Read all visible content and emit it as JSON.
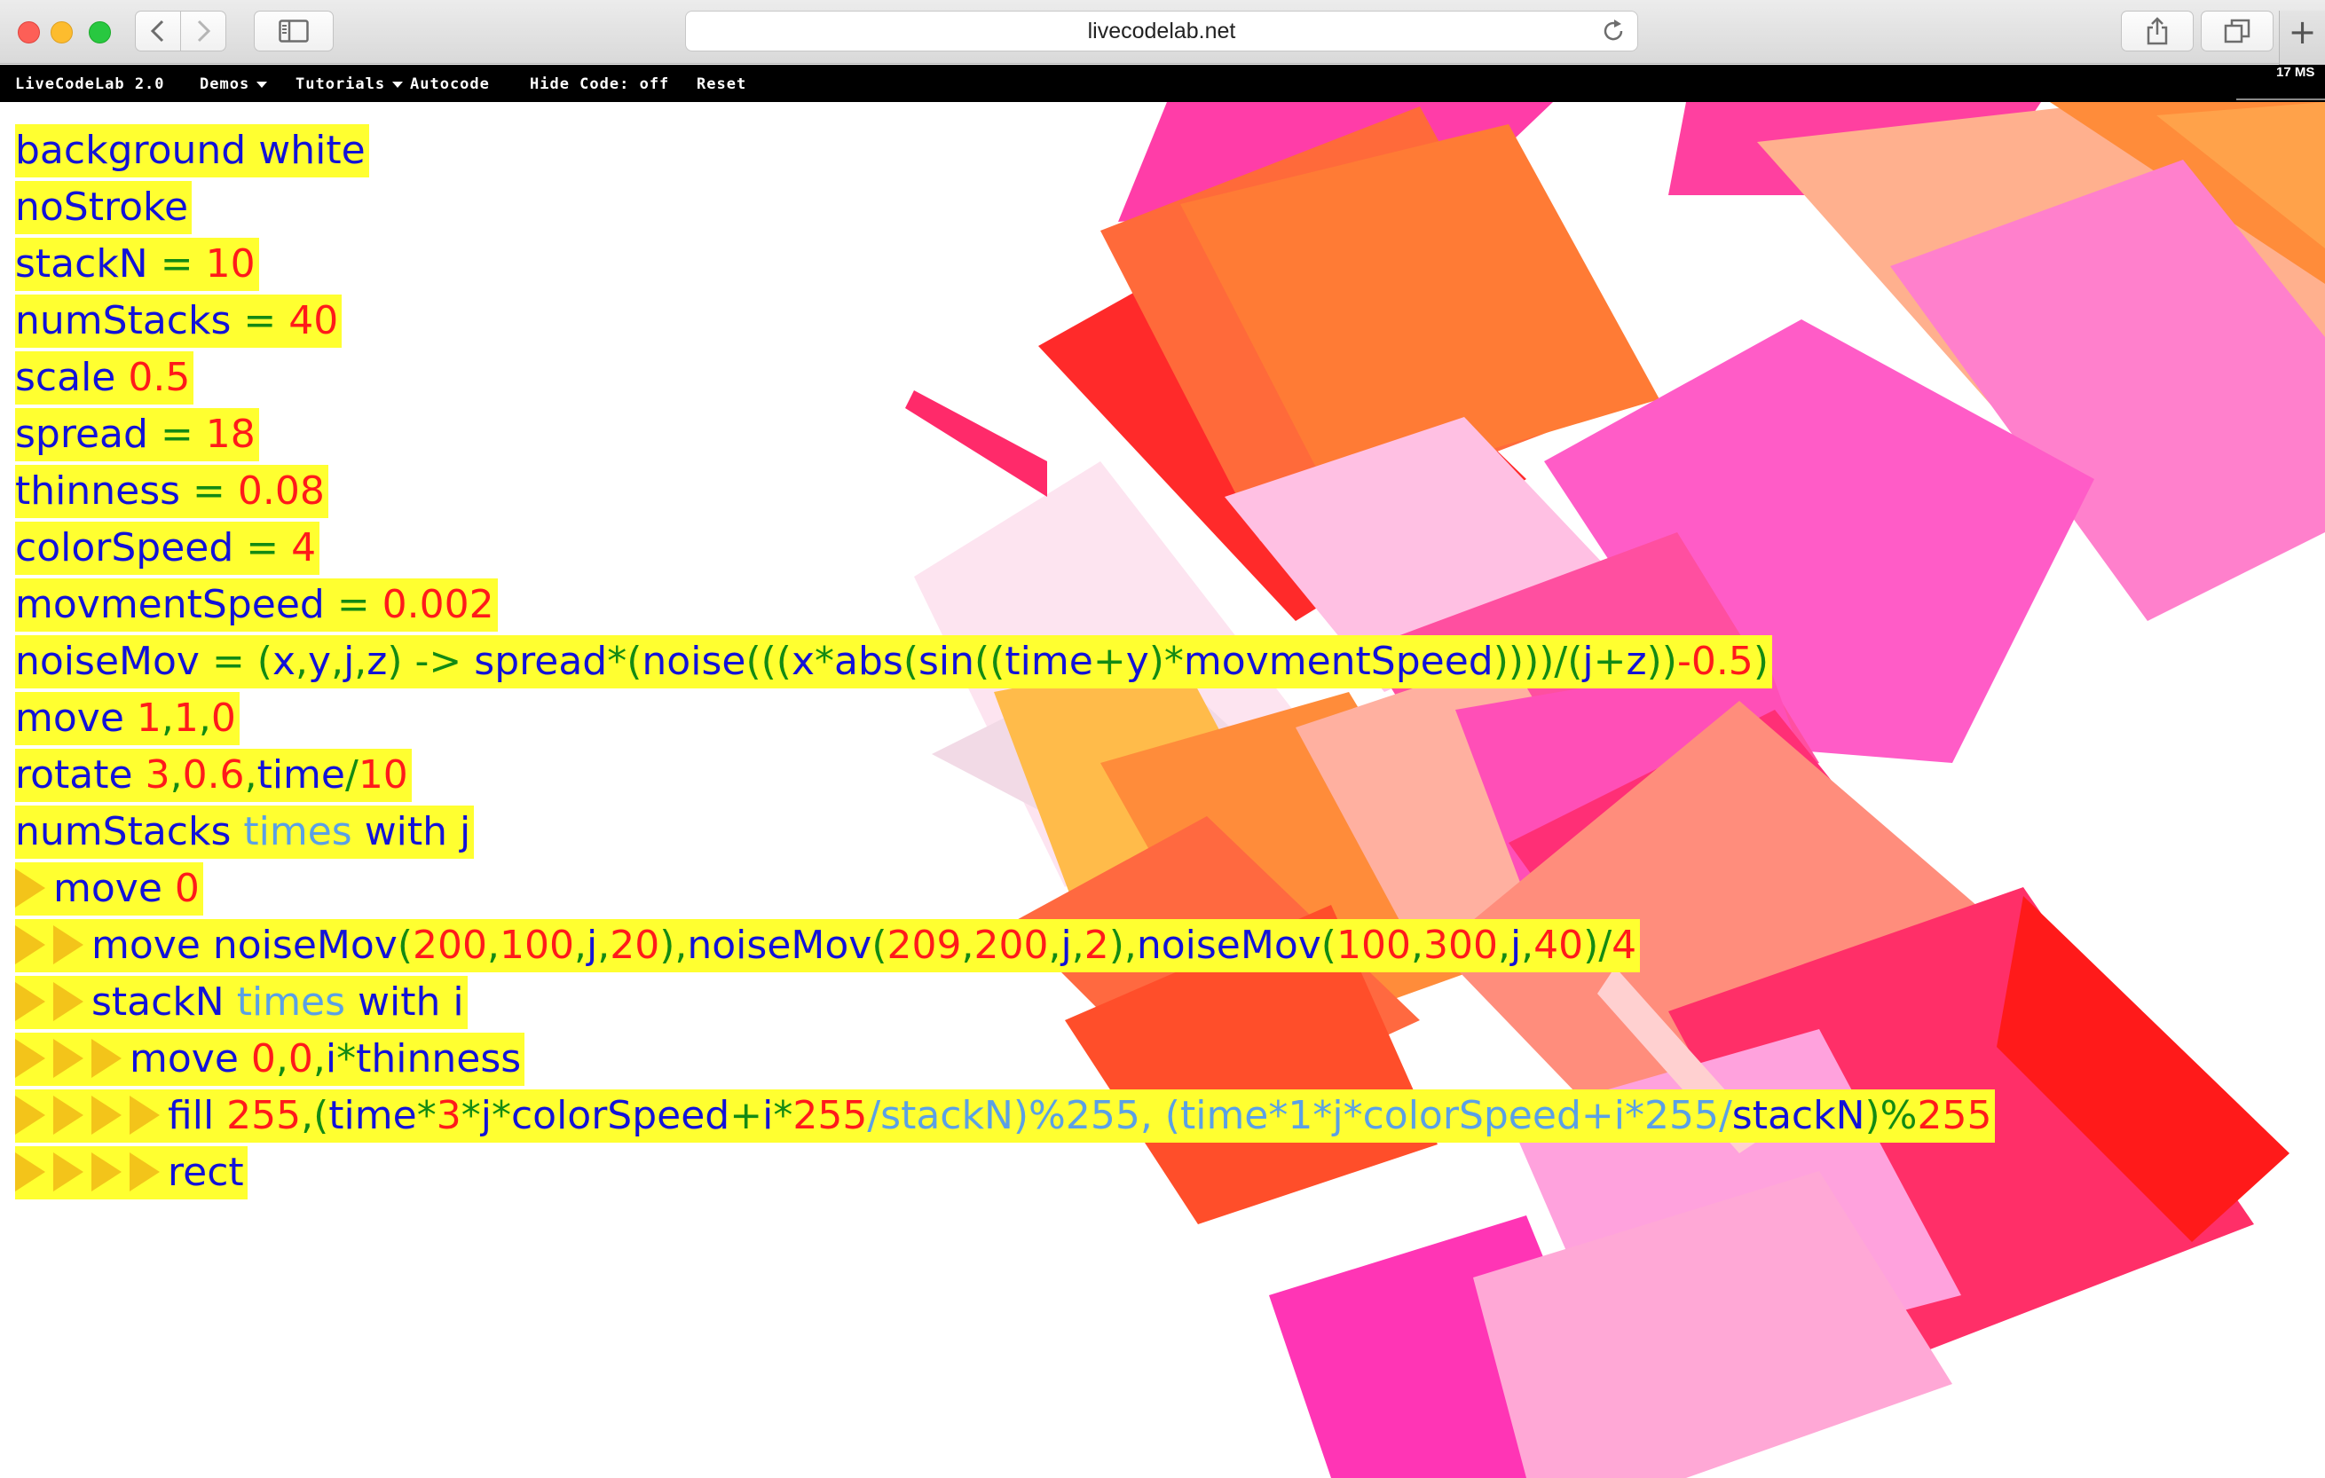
{
  "browser": {
    "url": "livecodelab.net",
    "icons": [
      "back-icon",
      "forward-icon",
      "sidebar-icon",
      "reload-icon",
      "share-icon",
      "tabs-icon",
      "new-tab-icon"
    ]
  },
  "menu": {
    "brand": "LiveCodeLab 2.0",
    "demos": "Demos",
    "tutorials": "Tutorials",
    "autocode": "Autocode",
    "hide_code": "Hide Code: off",
    "reset": "Reset",
    "stats": "17 MS"
  },
  "colors": {
    "highlight": "#ffff30",
    "identifier": "#1212d8",
    "number": "#ff1a1a",
    "operator": "#138a13",
    "keyword": "#5aa0e6",
    "indent_marker": "#f3c41a"
  },
  "code": {
    "l1": [
      "background",
      " white"
    ],
    "l2": [
      "noStroke"
    ],
    "l3": [
      "stackN",
      " = ",
      "10"
    ],
    "l4": [
      "numStacks",
      " = ",
      "40"
    ],
    "l5": [
      "scale",
      " 0.5"
    ],
    "l6": [
      "spread",
      " = ",
      "18"
    ],
    "l7": [
      "thinness",
      " = ",
      "0.08"
    ],
    "l8": [
      "colorSpeed",
      " = ",
      "4"
    ],
    "l9": [
      "movmentSpeed",
      " = ",
      "0.002"
    ],
    "l10": [
      "noiseMov",
      " = (",
      "x",
      ",",
      "y",
      ",",
      "j",
      ",",
      "z",
      ") -> ",
      "spread",
      "*(",
      "noise",
      "(((",
      "x",
      "*",
      "abs",
      "(",
      "sin",
      "((",
      "time",
      "+",
      "y",
      ")",
      "*",
      "movmentSpeed",
      "))))/(",
      "j",
      "+",
      "z",
      "))",
      "-0.5",
      ")"
    ],
    "l11": [
      "move",
      " 1",
      ",",
      "1",
      ",",
      "0"
    ],
    "l12": [
      "rotate",
      " 3",
      ",",
      "0.6",
      ",",
      "time",
      "/",
      "10"
    ],
    "l13": [
      "numStacks",
      " times",
      " with",
      " j"
    ],
    "l14": [
      "move",
      " 0"
    ],
    "l15": [
      "move",
      " noiseMov",
      "(",
      "200",
      ",",
      "100",
      ",",
      "j",
      ",",
      "20",
      "),",
      "noiseMov",
      "(",
      "209",
      ",",
      "200",
      ",",
      "j",
      ",",
      "2",
      "),",
      "noiseMov",
      "(",
      "100",
      ",",
      "300",
      ",",
      "j",
      ",",
      "40",
      ")/",
      "4"
    ],
    "l16": [
      "stackN",
      " times",
      " with",
      " i"
    ],
    "l17": [
      "move",
      " 0",
      ",",
      "0",
      ",",
      "i",
      "*",
      "thinness"
    ],
    "l18": [
      "fill",
      " 255",
      ",(",
      "time",
      "*",
      "3",
      "*",
      "j",
      "*",
      "colorSpeed",
      "+",
      "i",
      "*",
      "255",
      "/stackN)%255, (time*1*j*colorSpeed+i*255/",
      "stackN",
      ")%",
      "255"
    ],
    "l19": [
      "rect"
    ]
  }
}
